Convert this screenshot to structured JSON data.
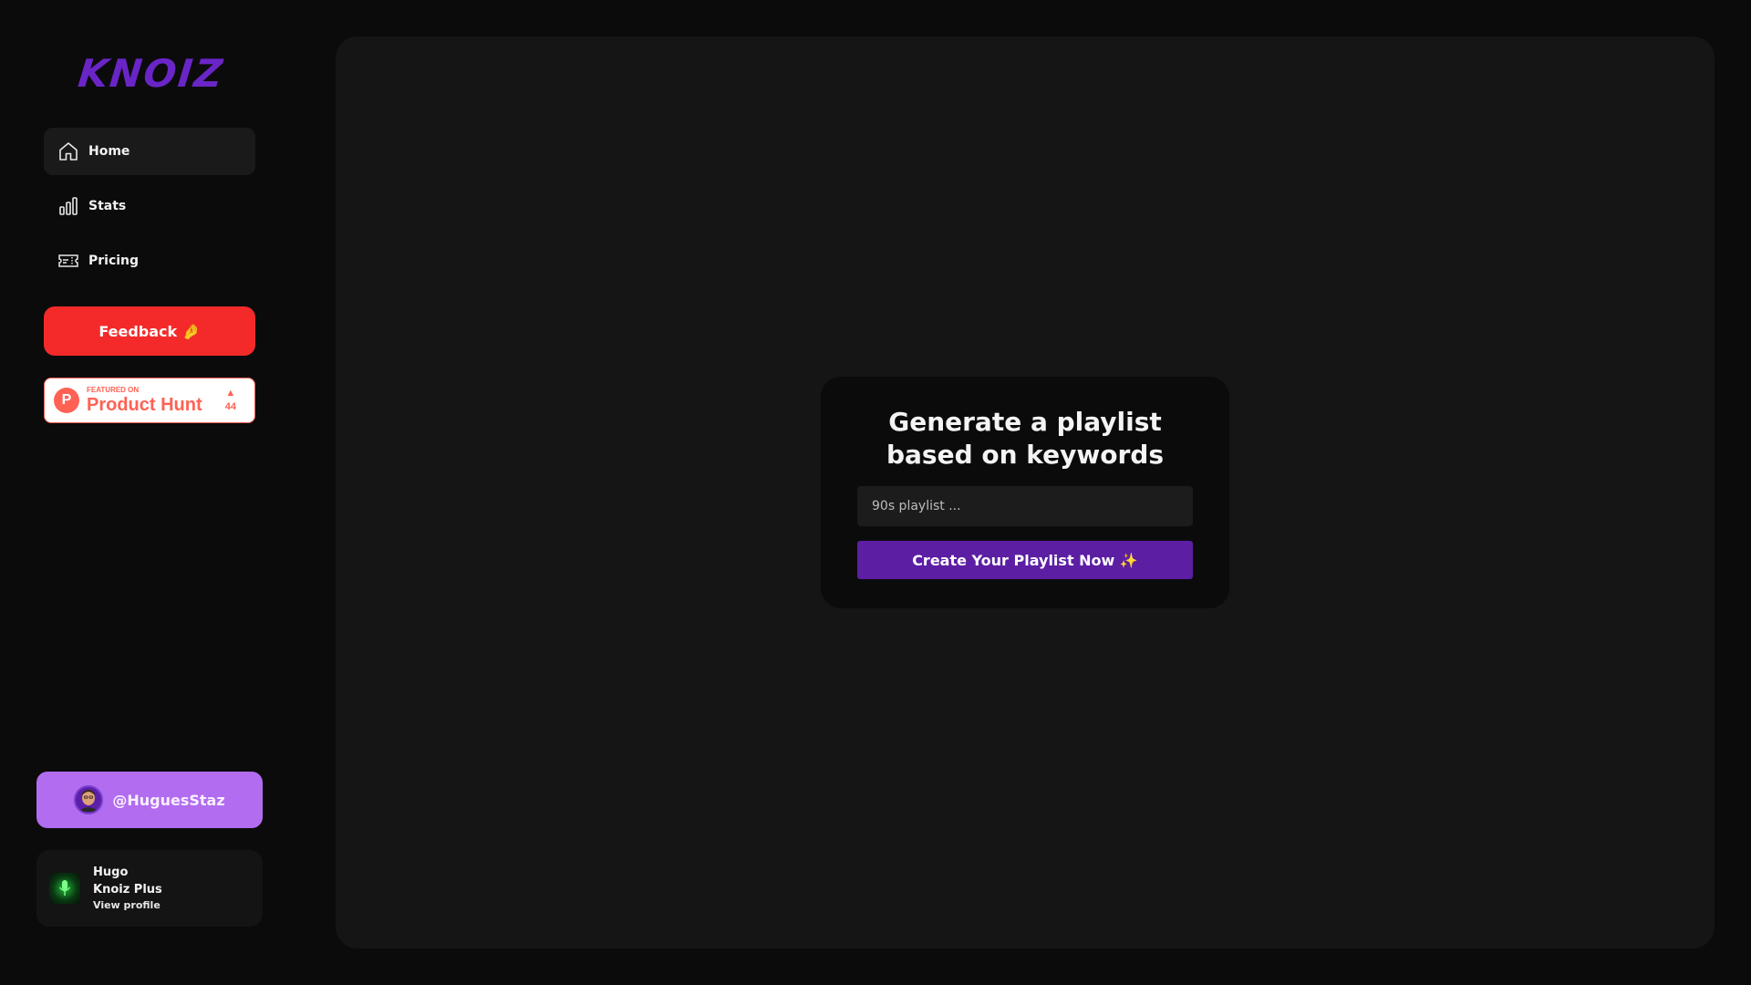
{
  "brand": {
    "logo_text": "KNOIZ",
    "color": "#6a25c7"
  },
  "sidebar": {
    "nav": [
      {
        "label": "Home",
        "icon": "home-icon",
        "active": true
      },
      {
        "label": "Stats",
        "icon": "bar-chart-icon",
        "active": false
      },
      {
        "label": "Pricing",
        "icon": "ticket-icon",
        "active": false
      }
    ],
    "feedback_label": "Feedback 🤌",
    "product_hunt": {
      "small_text": "FEATURED ON",
      "big_text": "Product Hunt",
      "logo_letter": "P",
      "arrow": "▲",
      "votes": "44"
    },
    "twitter": {
      "handle": "@HuguesStaz"
    },
    "profile": {
      "name": "Hugo",
      "plan": "Knoiz Plus",
      "link": "View profile"
    }
  },
  "main": {
    "title": "Generate a playlist based on keywords",
    "input_placeholder": "90s playlist ...",
    "input_value": "",
    "button_label": "Create Your Playlist Now ✨"
  }
}
